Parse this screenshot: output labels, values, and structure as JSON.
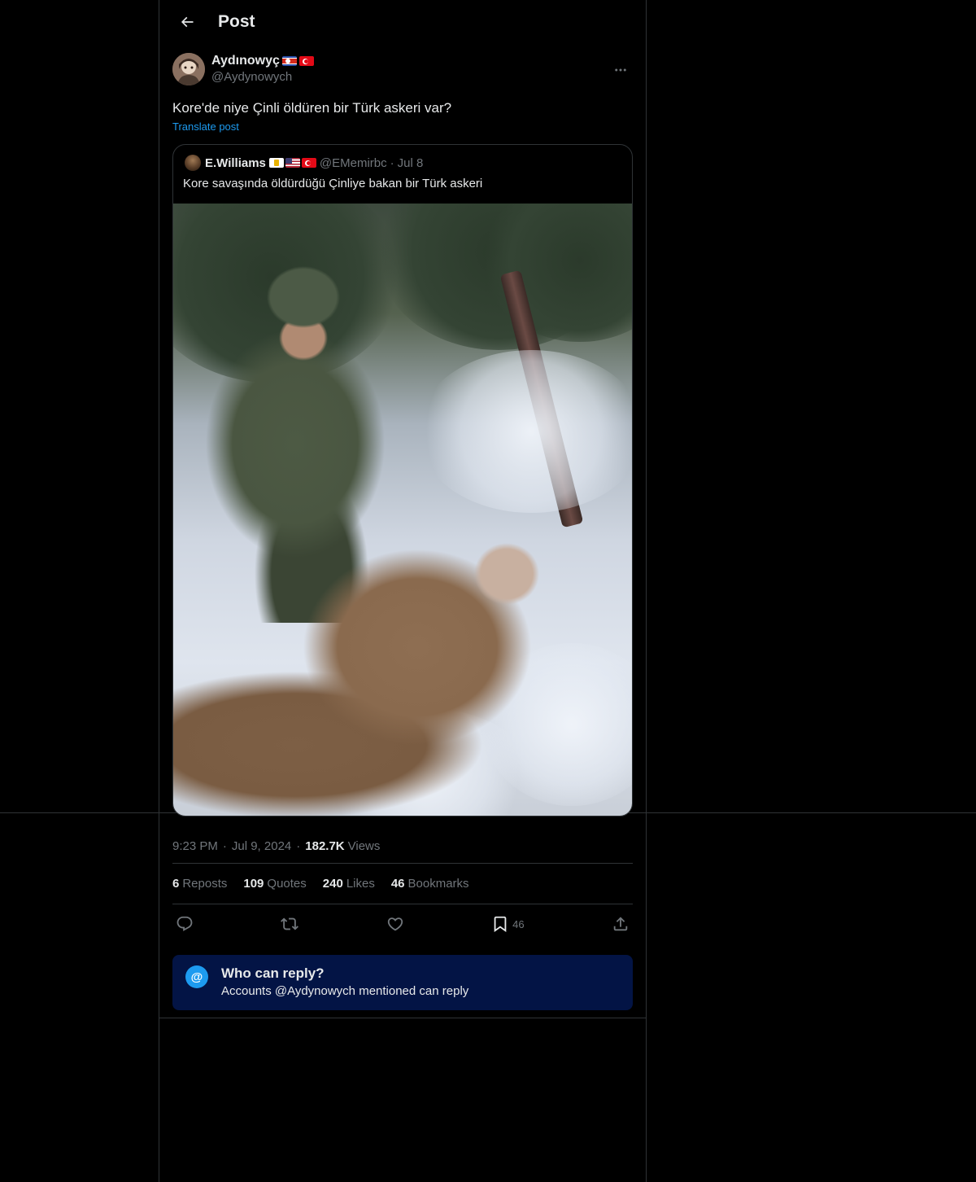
{
  "header": {
    "title": "Post"
  },
  "post": {
    "author": {
      "display_name": "Aydınowyç",
      "handle": "@Aydynowych"
    },
    "text": "Kore'de niye Çinli öldüren bir Türk askeri var?",
    "translate_label": "Translate post",
    "quote": {
      "display_name": "E.Williams",
      "handle": "@EMemirbc",
      "dot": "·",
      "date": "Jul 8",
      "text": "Kore savaşında öldürdüğü Çinliye bakan bir Türk askeri"
    },
    "meta": {
      "time": "9:23 PM",
      "sep": "·",
      "date": "Jul 9, 2024",
      "sep2": "·",
      "views_count": "182.7K",
      "views_label": "Views"
    },
    "stats": {
      "reposts_count": "6",
      "reposts_label": "Reposts",
      "quotes_count": "109",
      "quotes_label": "Quotes",
      "likes_count": "240",
      "likes_label": "Likes",
      "bookmarks_count": "46",
      "bookmarks_label": "Bookmarks"
    },
    "actions": {
      "bookmark_count": "46"
    },
    "reply_restriction": {
      "title": "Who can reply?",
      "subtitle": "Accounts @Aydynowych mentioned can reply",
      "icon": "@"
    }
  },
  "colors": {
    "background": "#000000",
    "text": "#e7e9ea",
    "muted": "#71767b",
    "accent": "#1d9bf0",
    "border": "#2f3336",
    "reply_box": "#031445"
  }
}
